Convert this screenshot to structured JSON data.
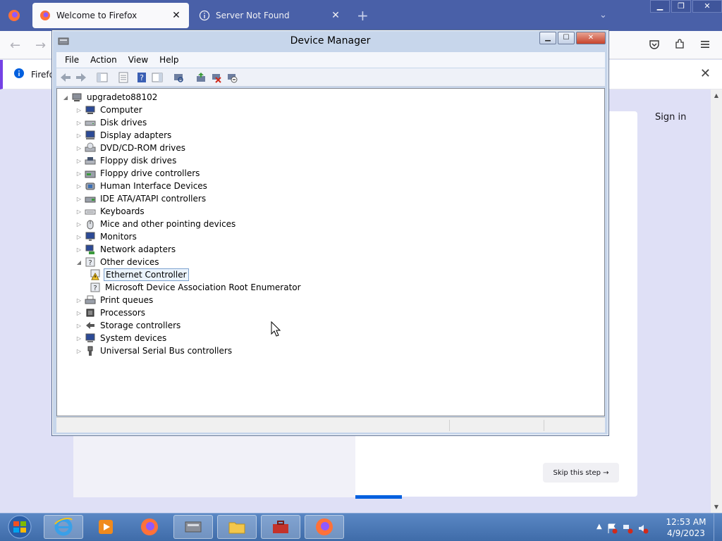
{
  "browser": {
    "tabs": [
      {
        "label": "Welcome to Firefox",
        "active": true
      },
      {
        "label": "Server Not Found",
        "active": false
      }
    ],
    "notice_text": "Firefo",
    "page": {
      "sign_in": "Sign in",
      "skip_button": "Skip this step →"
    }
  },
  "device_manager": {
    "title": "Device Manager",
    "menu": [
      "File",
      "Action",
      "View",
      "Help"
    ],
    "root": "upgradeto88102",
    "tree": [
      {
        "label": "Computer",
        "icon": "computer-icon"
      },
      {
        "label": "Disk drives",
        "icon": "disk-drive-icon"
      },
      {
        "label": "Display adapters",
        "icon": "display-adapter-icon"
      },
      {
        "label": "DVD/CD-ROM drives",
        "icon": "dvd-drive-icon"
      },
      {
        "label": "Floppy disk drives",
        "icon": "floppy-disk-icon"
      },
      {
        "label": "Floppy drive controllers",
        "icon": "floppy-controller-icon"
      },
      {
        "label": "Human Interface Devices",
        "icon": "hid-icon"
      },
      {
        "label": "IDE ATA/ATAPI controllers",
        "icon": "ide-controller-icon"
      },
      {
        "label": "Keyboards",
        "icon": "keyboard-icon"
      },
      {
        "label": "Mice and other pointing devices",
        "icon": "mouse-icon"
      },
      {
        "label": "Monitors",
        "icon": "monitor-icon"
      },
      {
        "label": "Network adapters",
        "icon": "network-adapter-icon"
      },
      {
        "label": "Other devices",
        "icon": "unknown-device-icon",
        "expanded": true,
        "children": [
          {
            "label": "Ethernet Controller",
            "icon": "warning-device-icon",
            "selected": true
          },
          {
            "label": "Microsoft Device Association Root Enumerator",
            "icon": "unknown-device-icon"
          }
        ]
      },
      {
        "label": "Print queues",
        "icon": "printer-icon"
      },
      {
        "label": "Processors",
        "icon": "processor-icon"
      },
      {
        "label": "Storage controllers",
        "icon": "storage-controller-icon"
      },
      {
        "label": "System devices",
        "icon": "system-device-icon"
      },
      {
        "label": "Universal Serial Bus controllers",
        "icon": "usb-icon"
      }
    ]
  },
  "taskbar": {
    "time": "12:53 AM",
    "date": "4/9/2023"
  },
  "colors": {
    "firefox_tabbar": "#4960a8",
    "taskbar": "#4a78b8",
    "selection": "#ebf4fd",
    "accent_progress": "#0060df"
  }
}
